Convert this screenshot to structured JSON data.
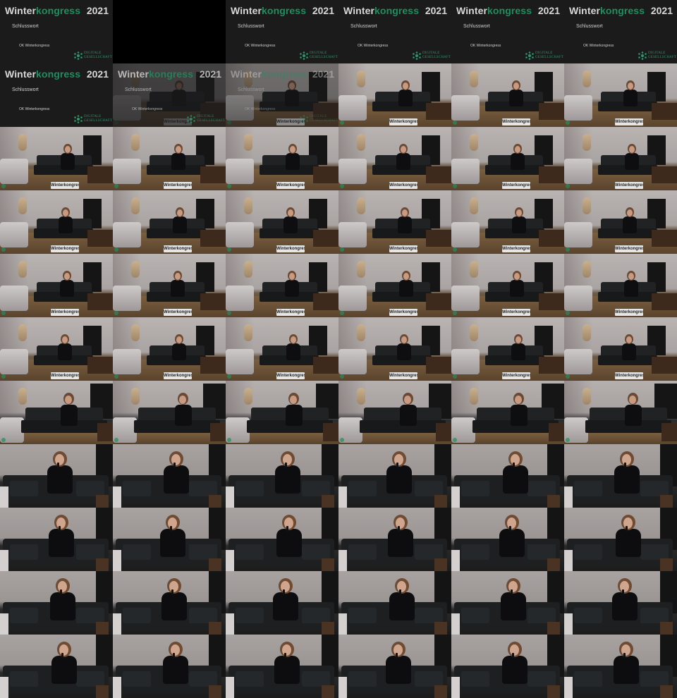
{
  "title_card": {
    "title_part1": "Winter",
    "title_part2": "kongress",
    "year": "2021",
    "subtitle": "Schlusswort",
    "organizer": "OK Winterkongress",
    "logo_line1": "DIGITALE",
    "logo_line2": "GESELLSCHAFT",
    "accent_color": "#1f8f5f",
    "logo_icon": "digitale-gesellschaft-logo-icon"
  },
  "sign_text": "Winterkongress",
  "grid": {
    "columns": 6,
    "rows": 11,
    "cells": [
      "title",
      "black",
      "title",
      "title",
      "title",
      "title",
      "title",
      "title-fade",
      "title-fade2",
      "wide",
      "wide",
      "wide",
      "wide",
      "wide",
      "wide",
      "wide",
      "wide",
      "wide",
      "wide",
      "wide",
      "wide",
      "wide",
      "wide",
      "wide",
      "wide",
      "wide",
      "wide",
      "wide",
      "wide",
      "wide",
      "wide",
      "wide",
      "wide",
      "wide",
      "wide",
      "wide",
      "mid",
      "mid",
      "mid",
      "mid",
      "mid",
      "mid",
      "close",
      "close",
      "close",
      "close",
      "close",
      "close",
      "close",
      "close",
      "close",
      "close",
      "close",
      "close",
      "close",
      "close",
      "close",
      "close",
      "close",
      "close",
      "close",
      "close",
      "close",
      "close",
      "close",
      "close"
    ]
  }
}
